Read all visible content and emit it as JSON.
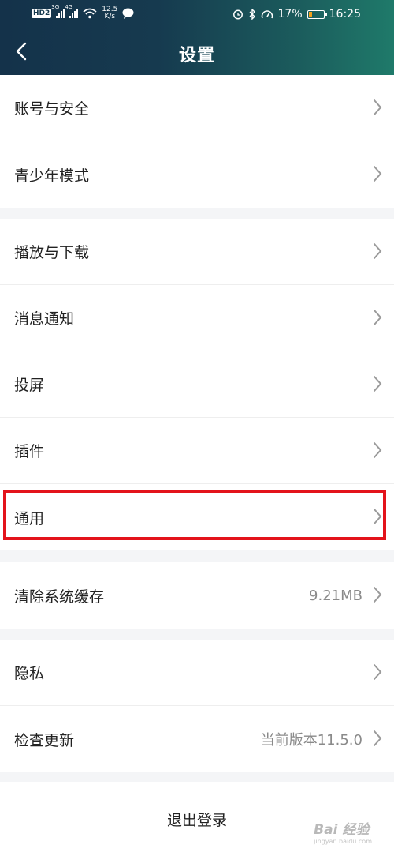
{
  "status_bar": {
    "network_badge": "HD",
    "network_badge_sub": "2",
    "signal1_type": "3G",
    "signal2_type": "4G",
    "speed_value": "12.5",
    "speed_unit": "K/s",
    "battery": "17%",
    "time": "16:25"
  },
  "header": {
    "title": "设置"
  },
  "groups": [
    {
      "items": [
        {
          "label": "账号与安全"
        },
        {
          "label": "青少年模式"
        }
      ]
    },
    {
      "items": [
        {
          "label": "播放与下载"
        },
        {
          "label": "消息通知"
        },
        {
          "label": "投屏"
        },
        {
          "label": "插件"
        },
        {
          "label": "通用"
        }
      ]
    },
    {
      "items": [
        {
          "label": "清除系统缓存",
          "value": "9.21MB"
        }
      ]
    },
    {
      "items": [
        {
          "label": "隐私"
        },
        {
          "label": "检查更新",
          "value": "当前版本11.5.0"
        }
      ]
    }
  ],
  "logout": {
    "label": "退出登录"
  },
  "watermark": {
    "text": "Bai 经验",
    "sub": "jingyan.baidu.com"
  },
  "colors": {
    "highlight": "#e3131b",
    "header_start": "#14324a",
    "header_end": "#1f7a6a"
  }
}
